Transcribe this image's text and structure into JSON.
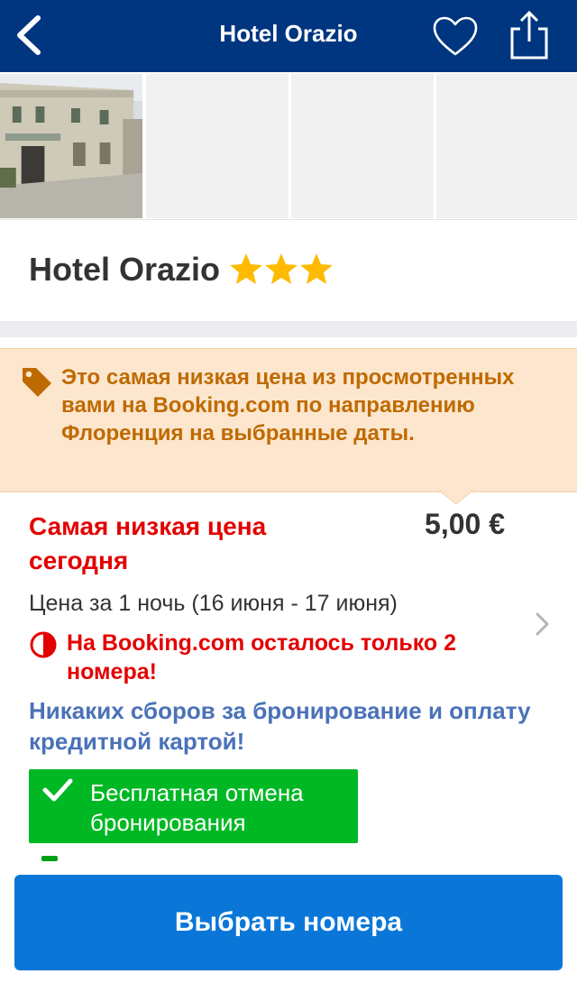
{
  "header": {
    "title": "Hotel Orazio",
    "back_icon": "back-chevron-icon",
    "favorite_icon": "heart-outline-icon",
    "share_icon": "share-icon",
    "background": "#003580"
  },
  "photos": {
    "items": [
      {
        "kind": "hotel-facade-photo"
      },
      {
        "kind": "placeholder"
      },
      {
        "kind": "placeholder"
      },
      {
        "kind": "placeholder"
      }
    ]
  },
  "hotel": {
    "name": "Hotel Orazio",
    "star_rating": 3,
    "star_color": "#febb02"
  },
  "banner": {
    "icon": "price-tag-icon",
    "text": "Это самая низкая цена из просмотренных вами на Booking.com по направлению Флоренция на выбранные даты.",
    "background": "#fce6cd",
    "text_color": "#bf6a00"
  },
  "offer": {
    "lowest_label": "Самая низкая цена сегодня",
    "price": "5,00 €",
    "per_night": "Цена за 1 ночь (16 июня - 17 июня)",
    "rooms_left": "На Booking.com осталось только 2 номера!",
    "no_fees": "Никаких сборов за бронирование и оплату кредитной картой!",
    "free_cancellation": "Бесплатная отмена бронирования",
    "alert_color": "#e30000",
    "fees_color": "#4a72b8",
    "cancel_bg": "#00b823"
  },
  "cta": {
    "label": "Выбрать номера",
    "background": "#0a77d8"
  }
}
